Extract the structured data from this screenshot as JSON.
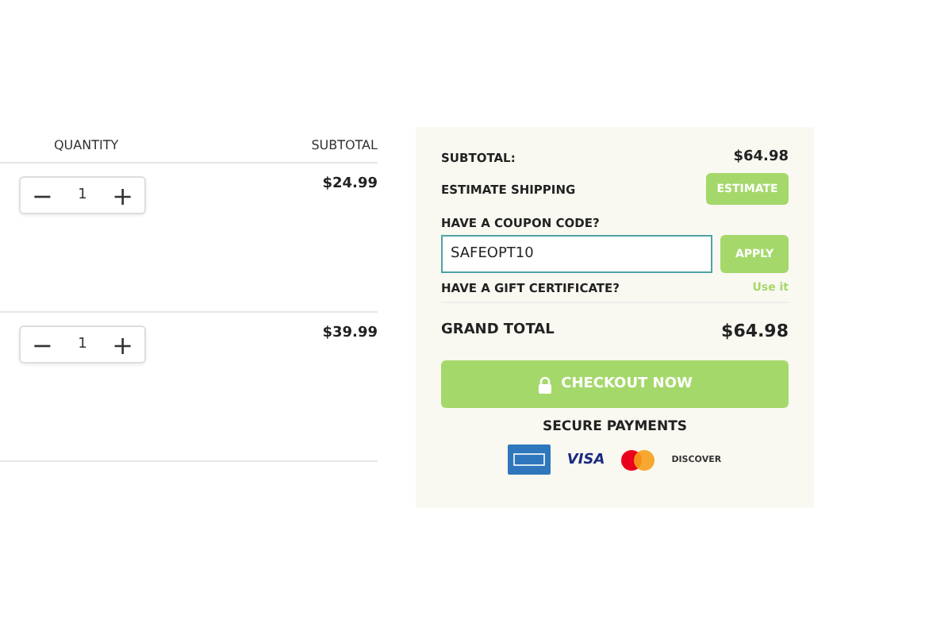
{
  "cart": {
    "columns": [
      "QUANTITY",
      "SUBTOTAL"
    ],
    "rows": [
      {
        "quantity": "1",
        "minus": "−",
        "plus": "+",
        "subtotal": "$24.99"
      },
      {
        "quantity": "1",
        "minus": "−",
        "plus": "+",
        "subtotal": "$39.99"
      }
    ]
  },
  "summary": {
    "subtotal_label": "SUBTOTAL:",
    "subtotal": "$64.98",
    "shipping_label": "ESTIMATE SHIPPING",
    "estimate_button": "ESTIMATE",
    "coupon_label": "HAVE A COUPON CODE?",
    "coupon_value": "SAFEOPT10",
    "apply_button": "APPLY",
    "gift_label": "HAVE A GIFT CERTIFICATE?",
    "gift_link": "Use it",
    "total_label": "GRAND TOTAL",
    "total": "$64.98",
    "checkout_button": "CHECKOUT NOW",
    "secure_label": "SECURE PAYMENTS",
    "payment_logos": [
      {
        "kind": "amex"
      },
      {
        "kind": "visa",
        "text": "VISA"
      },
      {
        "kind": "mastercard"
      },
      {
        "kind": "discover",
        "text": "DISCOVER"
      }
    ]
  }
}
